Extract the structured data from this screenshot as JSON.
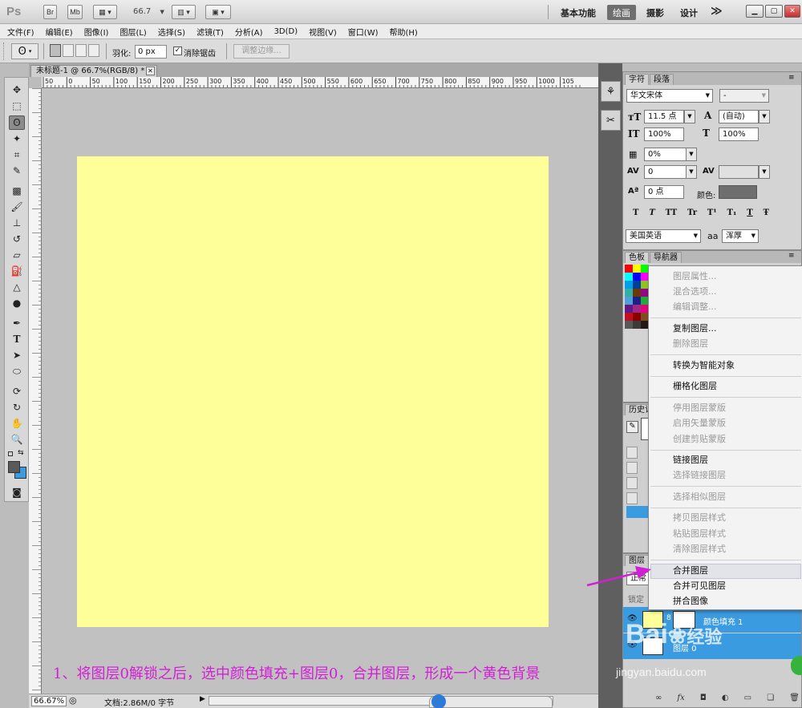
{
  "app": {
    "logo": "Ps",
    "bridge": "Br",
    "mini_bridge": "Mb",
    "zoom": "66.7",
    "workspaces": {
      "essentials": "基本功能",
      "painting": "绘画",
      "photography": "摄影",
      "design": "设计",
      "more": "≫"
    }
  },
  "menu": [
    "文件(F)",
    "编辑(E)",
    "图像(I)",
    "图层(L)",
    "选择(S)",
    "滤镜(T)",
    "分析(A)",
    "3D(D)",
    "视图(V)",
    "窗口(W)",
    "帮助(H)"
  ],
  "options": {
    "feather_label": "羽化:",
    "feather_value": "0 px",
    "antialias_label": "消除锯齿",
    "refine_edge": "调整边缘..."
  },
  "document": {
    "tab_title": "未标题-1 @ 66.7%(RGB/8) *",
    "ruler_top": [
      "50",
      "0",
      "50",
      "100",
      "150",
      "200",
      "250",
      "300",
      "350",
      "400",
      "450",
      "500",
      "550",
      "600",
      "650",
      "700",
      "750",
      "800",
      "850",
      "900",
      "950",
      "1000",
      "105"
    ],
    "canvas_color": "#ffff99",
    "instruction": "1、将图层0解锁之后，选中颜色填充+图层0，合并图层，形成一个黄色背景"
  },
  "status": {
    "zoom": "66.67%",
    "doc": "文档:2.86M/0 字节"
  },
  "character": {
    "tab_char": "字符",
    "tab_para": "段落",
    "font_family": "华文宋体",
    "font_style": "-",
    "size": "11.5 点",
    "leading": "(自动)",
    "vscale": "100%",
    "hscale": "100%",
    "tsume": "0%",
    "tracking": "0",
    "baseline": "0 点",
    "color_label": "颜色:",
    "style_buttons": [
      "T",
      "T",
      "TT",
      "Tr",
      "T¹",
      "T₁",
      "T",
      "Ŧ"
    ],
    "language": "美国英语",
    "aa_label": "a",
    "aa_value": "浑厚"
  },
  "swatches": {
    "tab_swatches": "色板",
    "tab_navigator": "导航器"
  },
  "history": {
    "tab": "历史记"
  },
  "layers": {
    "tab": "图层",
    "blend": "正常",
    "lock_label": "锁定",
    "fill_layer_name": "颜色填充 1",
    "layer0_name": "图层 0"
  },
  "context_menu": {
    "items": [
      {
        "label": "图层属性...",
        "enabled": false
      },
      {
        "label": "混合选项...",
        "enabled": false
      },
      {
        "label": "编辑调整...",
        "enabled": false
      },
      {
        "label": "复制图层...",
        "enabled": true
      },
      {
        "label": "删除图层",
        "enabled": false
      },
      {
        "label": "转换为智能对象",
        "enabled": true
      },
      {
        "label": "栅格化图层",
        "enabled": true
      },
      {
        "label": "停用图层蒙版",
        "enabled": false
      },
      {
        "label": "启用矢量蒙版",
        "enabled": false
      },
      {
        "label": "创建剪贴蒙版",
        "enabled": false
      },
      {
        "label": "链接图层",
        "enabled": true
      },
      {
        "label": "选择链接图层",
        "enabled": false
      },
      {
        "label": "选择相似图层",
        "enabled": false
      },
      {
        "label": "拷贝图层样式",
        "enabled": false
      },
      {
        "label": "粘贴图层样式",
        "enabled": false
      },
      {
        "label": "清除图层样式",
        "enabled": false
      },
      {
        "label": "合并图层",
        "enabled": true
      },
      {
        "label": "合并可见图层",
        "enabled": true
      },
      {
        "label": "拼合图像",
        "enabled": true
      }
    ]
  },
  "watermark": {
    "brand": "Bai",
    "brand2": "经验",
    "url": "jingyan.baidu.com"
  },
  "colors": {
    "arrow": "#d21fd6",
    "selection": "#3b9be0",
    "text_color_swatch": "#6e6e6e"
  }
}
